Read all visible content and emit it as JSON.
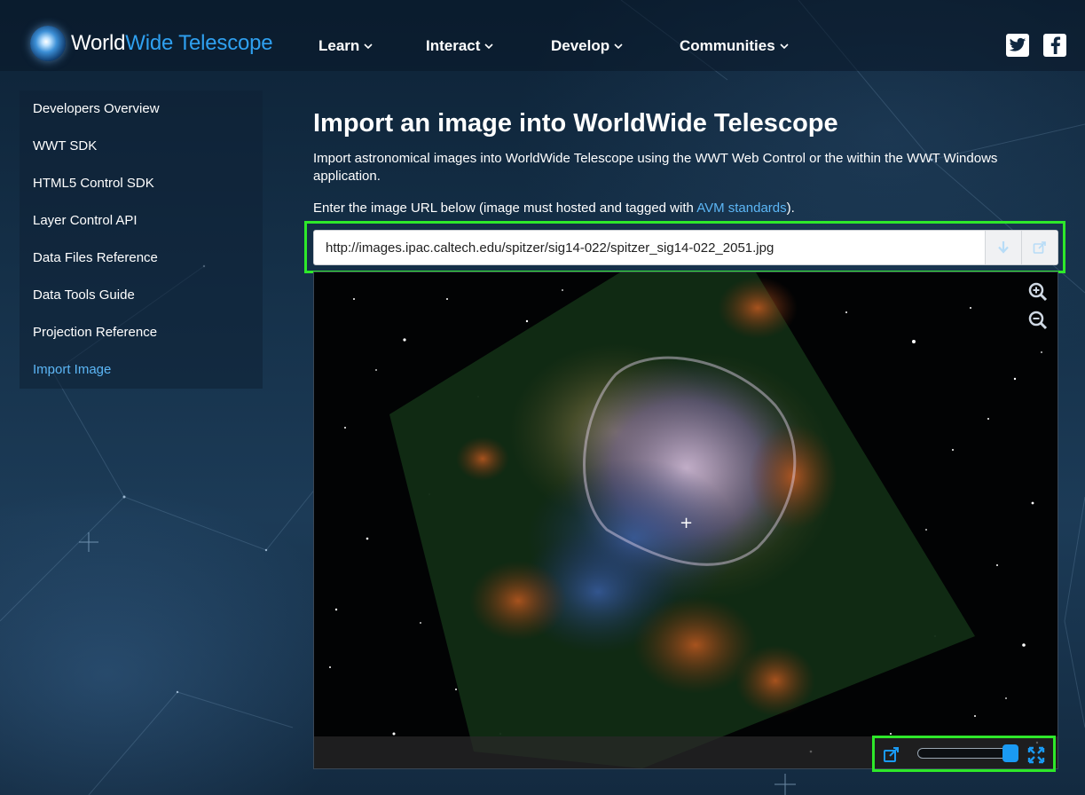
{
  "brand": {
    "word1": "World",
    "word2": "Wide Telescope",
    "accent": "#2fa0f0"
  },
  "nav": [
    {
      "label": "Learn"
    },
    {
      "label": "Interact"
    },
    {
      "label": "Develop"
    },
    {
      "label": "Communities"
    }
  ],
  "social": {
    "twitter": "twitter-icon",
    "facebook": "facebook-icon"
  },
  "sidebar": {
    "items": [
      {
        "label": "Developers Overview"
      },
      {
        "label": "WWT SDK"
      },
      {
        "label": "HTML5 Control SDK"
      },
      {
        "label": "Layer Control API"
      },
      {
        "label": "Data Files Reference"
      },
      {
        "label": "Data Tools Guide"
      },
      {
        "label": "Projection Reference"
      },
      {
        "label": "Import Image",
        "active": true
      }
    ],
    "active_color": "#5cb6f5"
  },
  "main": {
    "title": "Import an image into WorldWide Telescope",
    "intro": "Import astronomical images into WorldWide Telescope using the WWT Web Control or the within the WWT Windows application.",
    "instruction_before": "Enter the image URL below (image must hosted and tagged with ",
    "instruction_link": "AVM standards",
    "instruction_after": ").",
    "url_value": "http://images.ipac.caltech.edu/spitzer/sig14-022/spitzer_sig14-022_2051.jpg",
    "buttons": {
      "import": "download-arrow-icon",
      "open": "external-edit-icon"
    }
  },
  "viewer": {
    "crosshair": "+",
    "zoom_in": "zoom-in-icon",
    "zoom_out": "zoom-out-icon",
    "opacity_slider": 1.0,
    "icons": {
      "popout": "external-link-icon",
      "fullscreen": "fullscreen-icon"
    },
    "highlight_color": "#2ee82a"
  }
}
